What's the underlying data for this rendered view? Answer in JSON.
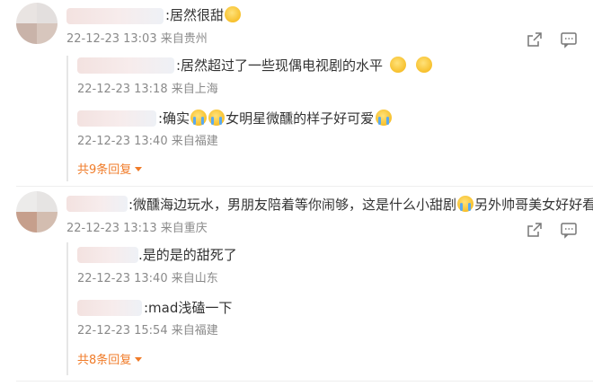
{
  "comments": [
    {
      "text": ":居然很甜",
      "meta": "22-12-23 13:03 来自贵州",
      "replies": [
        {
          "text": ":居然超过了一些现偶电视剧的水平",
          "meta": "22-12-23 13:18 来自上海"
        },
        {
          "text_a": ":确实",
          "text_b": "女明星微醺的样子好可爱",
          "meta": "22-12-23 13:40 来自福建"
        }
      ],
      "more_label": "共9条回复"
    },
    {
      "text_a": ":微醺海边玩水，男朋友陪着等你闹够，这是什么小甜剧",
      "text_b": "另外帅哥美女好好看",
      "meta": "22-12-23 13:13 来自重庆",
      "replies": [
        {
          "text": ".是的是的甜死了",
          "meta": "22-12-23 13:40 来自山东"
        },
        {
          "text": ":mad浅磕一下",
          "meta": "22-12-23 15:54 来自福建"
        }
      ],
      "more_label": "共8条回复"
    }
  ],
  "icons": {
    "share": "share-icon",
    "comment": "comment-icon",
    "emoji_hold": "emoji-holding-icon",
    "emoji_cry": "emoji-crying-icon",
    "emoji_tongue": "emoji-tongue-icon"
  },
  "colors": {
    "accent": "#f07b28",
    "meta": "#8a8a8a",
    "text": "#333333"
  }
}
